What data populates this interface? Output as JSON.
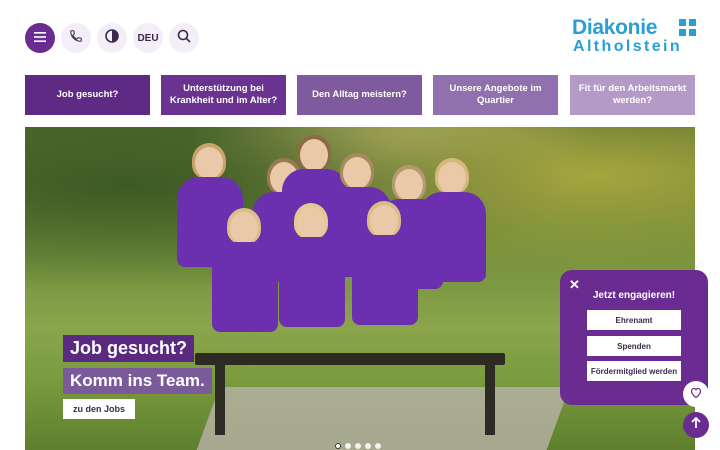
{
  "header": {
    "lang_label": "DEU",
    "icons": [
      "menu-icon",
      "phone-icon",
      "contrast-icon",
      "search-icon"
    ],
    "logo": {
      "line1": "Diakonie",
      "line2": "Altholstein"
    }
  },
  "nav": {
    "items": [
      {
        "label": "Job gesucht?",
        "color": "#5e2a84"
      },
      {
        "label": "Unterstützung bei Krankheit und im Alter?",
        "color": "#6b3391"
      },
      {
        "label": "Den Alltag meistern?",
        "color": "#805a9e"
      },
      {
        "label": "Unsere Angebote im Quartier",
        "color": "#9070ad"
      },
      {
        "label": "Fit für den Arbeitsmarkt werden?",
        "color": "#b49ac7"
      }
    ]
  },
  "hero": {
    "caption_line1": "Job gesucht?",
    "caption_line2": "Komm ins Team.",
    "cta_label": "zu den Jobs",
    "slides_total": 5,
    "active_slide": 1
  },
  "engage_panel": {
    "title": "Jetzt engagieren!",
    "buttons": [
      "Ehrenamt",
      "Spenden",
      "Fördermitglied werden"
    ]
  },
  "colors": {
    "brand_purple": "#6a2c91",
    "logo_blue": "#2a9fd6"
  }
}
